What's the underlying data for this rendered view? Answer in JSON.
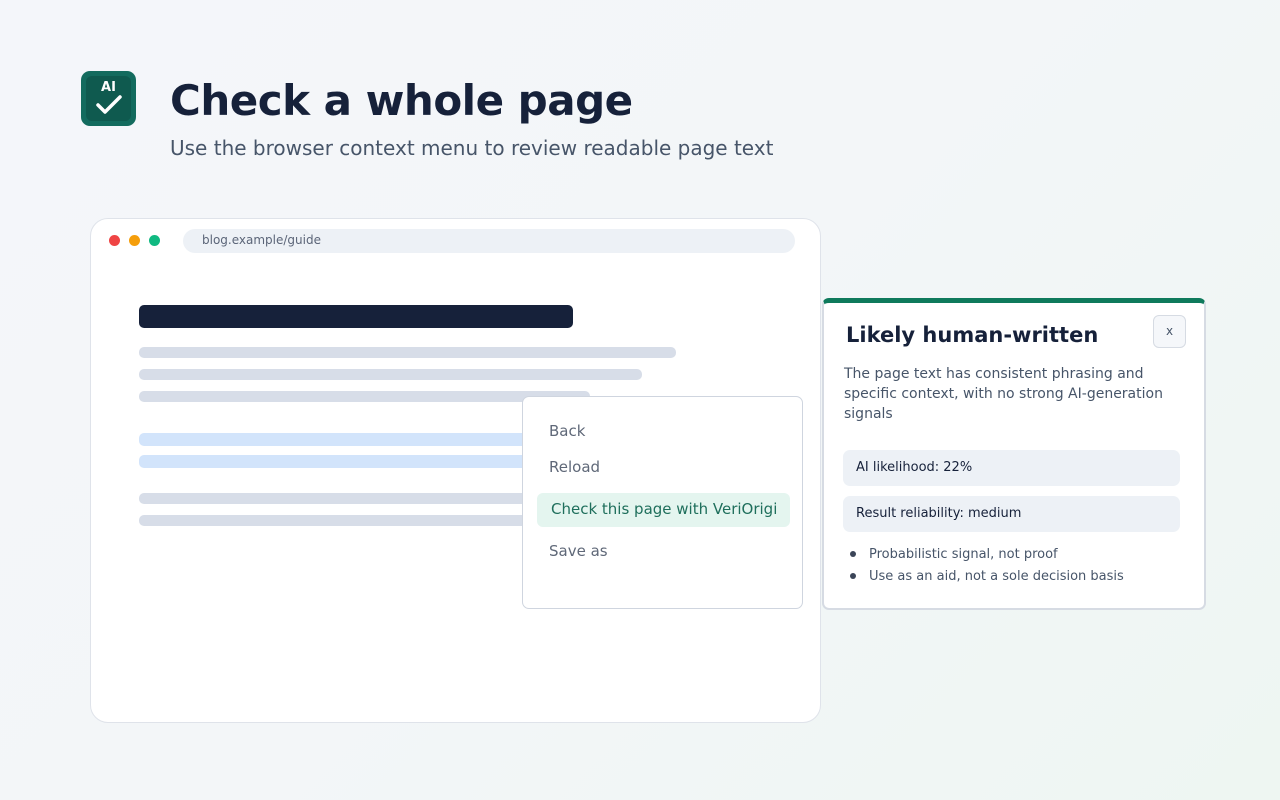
{
  "header": {
    "logo_text": "AI",
    "logo_icon": "checkmark-icon",
    "title": "Check a whole page",
    "subtitle": "Use the browser context menu to review readable page text"
  },
  "browser": {
    "url": "blog.example/guide"
  },
  "context_menu": {
    "items": [
      {
        "label": "Back",
        "highlighted": false
      },
      {
        "label": "Reload",
        "highlighted": false
      },
      {
        "label": "Check this page with VeriOrigi",
        "highlighted": true
      },
      {
        "label": "Save as",
        "highlighted": false
      }
    ]
  },
  "result_panel": {
    "title": "Likely human-written",
    "close_label": "x",
    "description": "The page text has consistent phrasing and specific context, with no strong AI-generation signals",
    "ai_likelihood": "AI likelihood: 22%",
    "reliability": "Result reliability: medium",
    "notes": [
      "Probabilistic signal, not proof",
      "Use as an aid, not a sole decision basis"
    ],
    "accent_color": "#0f7a5c"
  }
}
